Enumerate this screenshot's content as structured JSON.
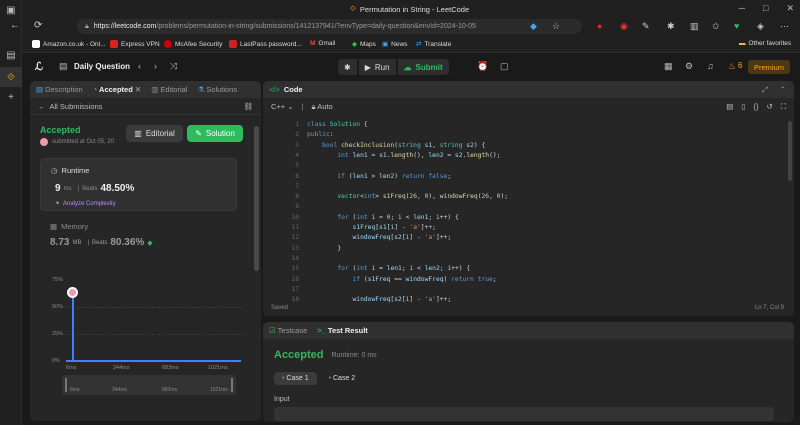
{
  "browser": {
    "tab_title": "Permutation in String - LeetCode",
    "url_host": "https://leetcode.com",
    "url_path": "/problems/permutation-in-string/submissions/1412137941/?envType=daily-question&envId=2024-10-05",
    "bookmarks": [
      "Amazon.co.uk - Onl...",
      "Express VPN",
      "McAfee Security",
      "LastPass password...",
      "Gmail",
      "Maps",
      "News",
      "Translate"
    ],
    "other_favorites": "Other favorites"
  },
  "lc": {
    "title": "Daily Question",
    "run": "Run",
    "submit": "Submit",
    "streak": "6",
    "premium": "Premium"
  },
  "left": {
    "tabs": [
      "Description",
      "Accepted",
      "Editorial",
      "Solutions"
    ],
    "all_submissions": "All Submissions",
    "status": "Accepted",
    "submitted": "submitted at Oct 05, 20",
    "editorial_btn": "Editorial",
    "solution_btn": "Solution",
    "runtime_label": "Runtime",
    "runtime_value": "9",
    "runtime_unit": "ms",
    "beats_label": "Beats",
    "runtime_beats": "48.50%",
    "analyze": "Analyze Complexity",
    "memory_label": "Memory",
    "memory_value": "8.73",
    "memory_unit": "MB",
    "memory_beats": "80.36%",
    "y_ticks": [
      "75%",
      "50%",
      "25%",
      "0%"
    ],
    "x_ticks": [
      "6ms",
      "344ms",
      "683ms",
      "1021ms"
    ]
  },
  "code": {
    "tab": "Code",
    "language": "C++",
    "auto": "Auto",
    "saved": "Saved",
    "cursor": "Ln 7, Col 9",
    "line_numbers": [
      "1",
      "2",
      "3",
      "4",
      "5",
      "6",
      "7",
      "8",
      "9",
      "10",
      "11",
      "12",
      "13",
      "14",
      "15",
      "16",
      "17",
      "18"
    ]
  },
  "result": {
    "tabs": [
      "Testcase",
      "Test Result"
    ],
    "status": "Accepted",
    "runtime": "Runtime: 0 ms",
    "case1": "Case 1",
    "case2": "Case 2",
    "input_label": "Input"
  }
}
